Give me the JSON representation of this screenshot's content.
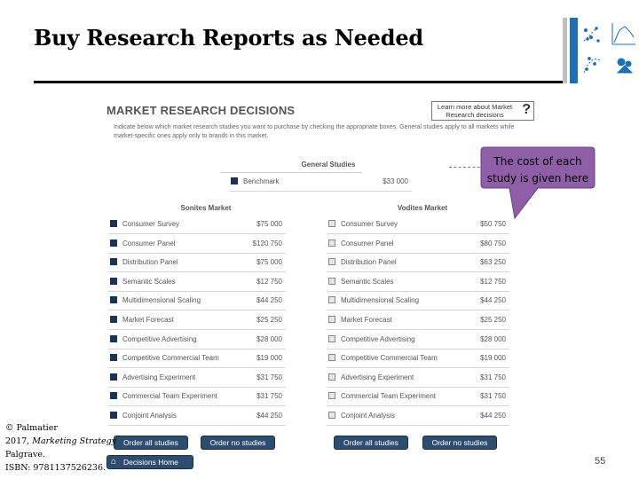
{
  "slide": {
    "title": "Buy Research Reports as Needed",
    "page_number": "55",
    "callout": "The cost of each study is given here",
    "copyright": {
      "line1": "© Palmatier",
      "year": "2017,",
      "book": "Marketing Strategy",
      "publisher": "Palgrave.",
      "isbn": "ISBN: 9781137526236."
    }
  },
  "panel": {
    "heading": "MARKET RESEARCH DECISIONS",
    "learn_more": "Learn more about Market Research decisions",
    "help_glyph": "?",
    "instructions": "Indicate below which market research studies you want to purchase by checking the appropriate boxes. General studies apply to all markets while market-specific ones apply only to brands in this market.",
    "general": {
      "label": "General Studies",
      "rows": [
        {
          "name": "Benchmark",
          "price": "$33 000",
          "checked": true
        }
      ]
    },
    "sonites": {
      "label": "Sonites Market",
      "rows": [
        {
          "name": "Consumer Survey",
          "price": "$75 000",
          "checked": true
        },
        {
          "name": "Consumer Panel",
          "price": "$120 750",
          "checked": true
        },
        {
          "name": "Distribution Panel",
          "price": "$75 000",
          "checked": true
        },
        {
          "name": "Semantic Scales",
          "price": "$12 750",
          "checked": true
        },
        {
          "name": "Multidimensional Scaling",
          "price": "$44 250",
          "checked": true
        },
        {
          "name": "Market Forecast",
          "price": "$25 250",
          "checked": true
        },
        {
          "name": "Competitive Advertising",
          "price": "$28 000",
          "checked": true
        },
        {
          "name": "Competitive Commercial Team",
          "price": "$19 000",
          "checked": true
        },
        {
          "name": "Advertising Experiment",
          "price": "$31 750",
          "checked": true
        },
        {
          "name": "Commercial Team Experiment",
          "price": "$31 750",
          "checked": true
        },
        {
          "name": "Conjoint Analysis",
          "price": "$44 250",
          "checked": true
        }
      ],
      "order_all": "Order all studies",
      "order_none": "Order no studies"
    },
    "vodites": {
      "label": "Vodites Market",
      "rows": [
        {
          "name": "Consumer Survey",
          "price": "$50 750",
          "checked": false
        },
        {
          "name": "Consumer Panel",
          "price": "$80 750",
          "checked": false
        },
        {
          "name": "Distribution Panel",
          "price": "$63 250",
          "checked": false
        },
        {
          "name": "Semantic Scales",
          "price": "$12 750",
          "checked": false
        },
        {
          "name": "Multidimensional Scaling",
          "price": "$44 250",
          "checked": false
        },
        {
          "name": "Market Forecast",
          "price": "$25 250",
          "checked": false
        },
        {
          "name": "Competitive Advertising",
          "price": "$28 000",
          "checked": false
        },
        {
          "name": "Competitive Commercial Team",
          "price": "$19 000",
          "checked": false
        },
        {
          "name": "Advertising Experiment",
          "price": "$31 750",
          "checked": false
        },
        {
          "name": "Commercial Team Experiment",
          "price": "$31 750",
          "checked": false
        },
        {
          "name": "Conjoint Analysis",
          "price": "$44 250",
          "checked": false
        }
      ],
      "order_all": "Order all studies",
      "order_none": "Order no studies"
    },
    "home_button": "Decisions Home",
    "home_icon": "home-icon"
  },
  "colors": {
    "checkbox_checked": "#1e3352",
    "button": "#2e4d6e",
    "callout_fill": "#8e5fa6",
    "deco_accent": "#1f6fb2"
  }
}
